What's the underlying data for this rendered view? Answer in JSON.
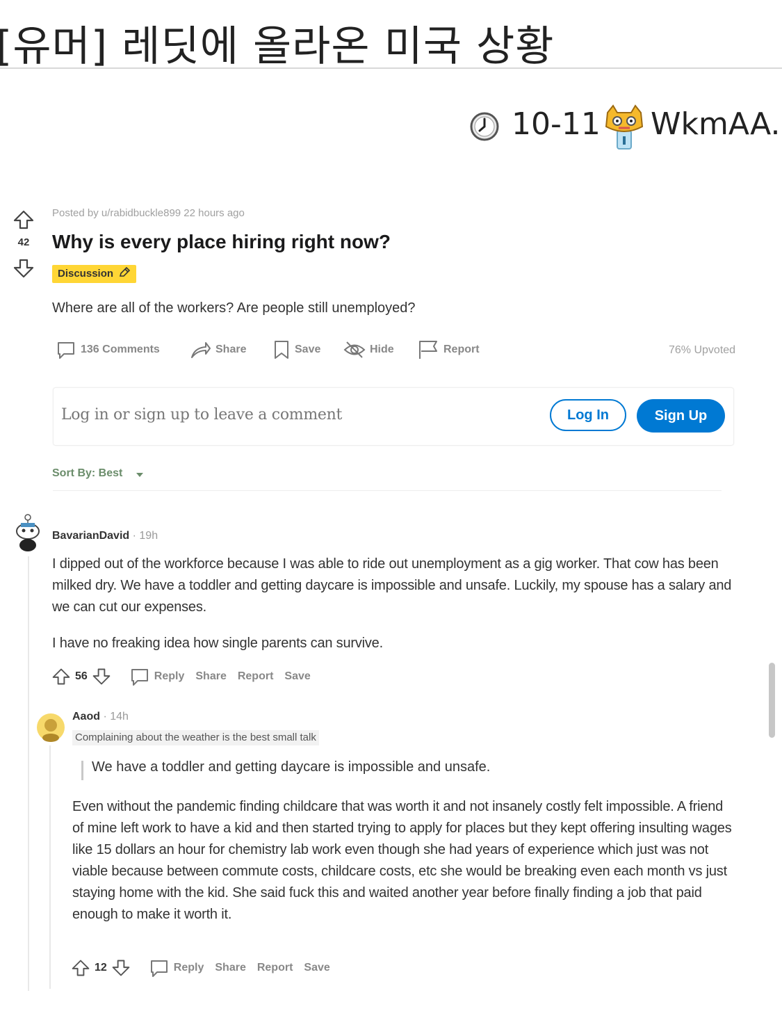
{
  "header": {
    "title": "[유머] 레딧에 올라온 미국 상황",
    "date": "10-11",
    "username": "WkmAA..",
    "clock_icon": "clock-icon",
    "avatar_icon": "cat-avatar-icon"
  },
  "post": {
    "posted_by": "Posted by u/rabidbuckle899 22 hours ago",
    "votes": "42",
    "title": "Why is every place hiring right now?",
    "flair": "Discussion",
    "body": "Where are all of the workers? Are people still unemployed?",
    "actions": {
      "comments": "136 Comments",
      "share": "Share",
      "save": "Save",
      "hide": "Hide",
      "report": "Report"
    },
    "upvoted": "76% Upvoted"
  },
  "comment_box": {
    "placeholder": "Log in or sign up to leave a comment",
    "login": "Log In",
    "signup": "Sign Up"
  },
  "sort": {
    "label": "Sort By: Best"
  },
  "comments": [
    {
      "author": "BavarianDavid",
      "time": "· 19h",
      "body1": "I dipped out of the workforce because I was able to ride out unemployment as a gig worker. That cow has been milked dry. We have a toddler and getting daycare is impossible and unsafe. Luckily, my spouse has a salary and we can cut our expenses.",
      "body2": "I have no freaking idea how single parents can survive.",
      "votes": "56",
      "reply": "Reply",
      "share": "Share",
      "report": "Report",
      "save": "Save"
    },
    {
      "author": "Aaod",
      "time": "· 14h",
      "flair": "Complaining about the weather is the best small talk",
      "quote": "We have a toddler and getting daycare is impossible and unsafe.",
      "body": "Even without the pandemic finding childcare that was worth it and not insanely costly felt impossible. A friend of mine left work to have a kid and then started trying to apply for places but they kept offering insulting wages like 15 dollars an hour for chemistry lab work even though she had years of experience which just was not viable because between commute costs, childcare costs, etc she would be breaking even each month vs just staying home with the kid. She said fuck this and waited another year before finally finding a job that paid enough to make it worth it.",
      "votes": "12",
      "reply": "Reply",
      "share": "Share",
      "report": "Report",
      "save": "Save"
    }
  ],
  "colors": {
    "reddit_blue": "#0079d3",
    "flair_yellow": "#ffd635",
    "sort_green": "#6b8d6b"
  }
}
